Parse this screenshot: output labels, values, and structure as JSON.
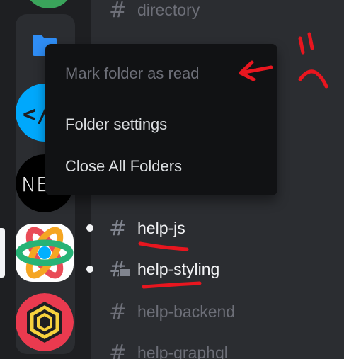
{
  "channels": [
    {
      "name": "directory",
      "unread": false
    },
    {
      "name": "help-js",
      "unread": true
    },
    {
      "name": "help-styling",
      "unread": true,
      "thread_icon": true
    },
    {
      "name": "help-backend",
      "unread": false
    },
    {
      "name": "help-graphql",
      "unread": false
    }
  ],
  "partially_hidden_channel_suffix": "e",
  "context_menu": {
    "items": [
      {
        "label": "Mark folder as read",
        "disabled": true
      },
      {
        "label": "Folder settings",
        "disabled": false
      },
      {
        "label": "Close All Folders",
        "disabled": false
      }
    ]
  },
  "annotations": {
    "handwritten_note": "ご\\",
    "color": "#e8161f"
  },
  "colors": {
    "rail_bg": "#1e1f22",
    "channel_bg": "#2b2d31",
    "menu_bg": "#111214",
    "folder_blue": "#2f8df5",
    "react_cyan": "#00b0ff"
  }
}
